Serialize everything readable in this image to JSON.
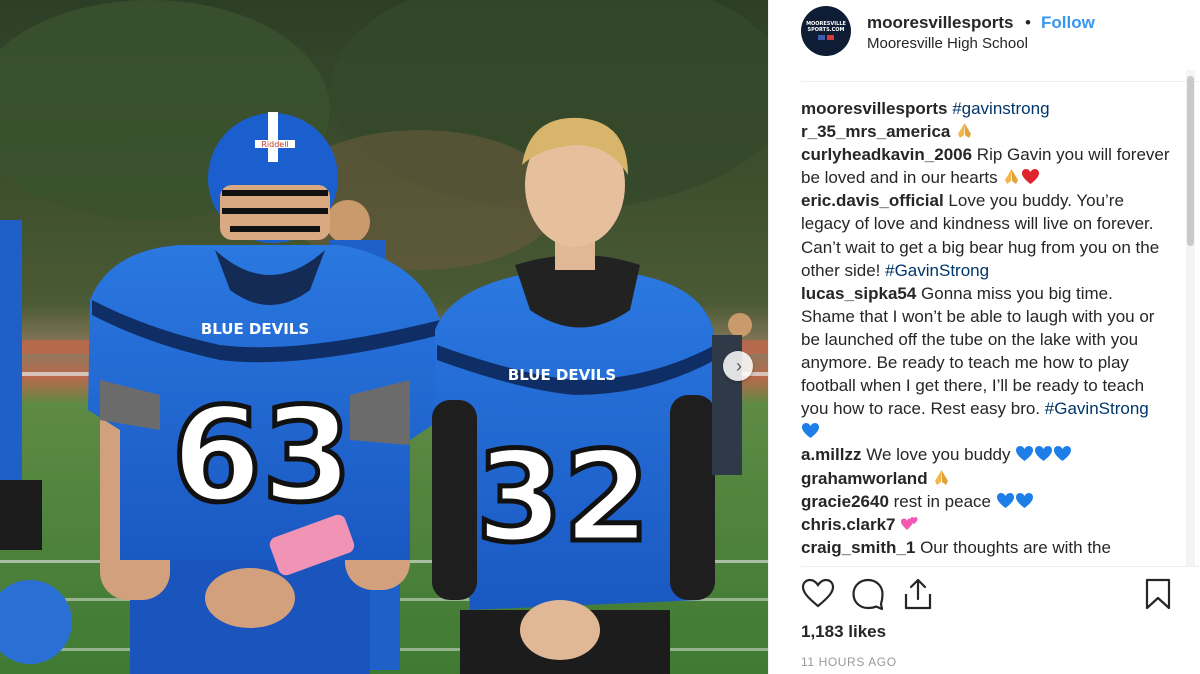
{
  "header": {
    "avatar_text": "MOORESVILLE SPORTS.COM",
    "username": "mooresvillesports",
    "separator": "•",
    "follow": "Follow",
    "location": "Mooresville High School"
  },
  "photo": {
    "jersey_left_number": "63",
    "jersey_right_number": "32",
    "jersey_text": "BLUE DEVILS",
    "helmet_brand": "Riddell",
    "colors": {
      "jersey": "#1e6bd6",
      "jersey_dark": "#0d3f8f",
      "field": "#4f7d3a",
      "sky_trees": "#2f4a2a"
    }
  },
  "comments": [
    {
      "user": "mooresvillesports",
      "text": "",
      "tag": "#gavinstrong",
      "after": "",
      "emoji": []
    },
    {
      "user": "r_35_mrs_america",
      "text": "",
      "tag": "",
      "after": "",
      "emoji": [
        "folded-hands"
      ]
    },
    {
      "user": "curlyheadkavin_2006",
      "text": "Rip Gavin you will forever be loved and in our hearts",
      "tag": "",
      "after": "",
      "emoji": [
        "folded-hands",
        "red-heart"
      ]
    },
    {
      "user": "eric.davis_official",
      "text": "Love you buddy. You’re legacy of love and kindness will live on forever. Can’t wait to get a big bear hug from you on the other side!",
      "tag": "#GavinStrong",
      "after": "",
      "emoji": []
    },
    {
      "user": "lucas_sipka54",
      "text": "Gonna miss you big time. Shame that I won’t be able to laugh with you or be launched off the tube on the lake with you anymore. Be ready to teach me how to play football when I get there, I’ll be ready to teach you how to race. Rest easy bro.",
      "tag": "#GavinStrong",
      "after": "",
      "emoji": [
        "blue-heart"
      ]
    },
    {
      "user": "a.millzz",
      "text": "We love you buddy",
      "tag": "",
      "after": "",
      "emoji": [
        "blue-heart",
        "blue-heart",
        "blue-heart"
      ]
    },
    {
      "user": "grahamworland",
      "text": "",
      "tag": "",
      "after": "",
      "emoji": [
        "folded-hands"
      ]
    },
    {
      "user": "gracie2640",
      "text": "rest in peace",
      "tag": "",
      "after": "",
      "emoji": [
        "blue-heart",
        "blue-heart"
      ]
    },
    {
      "user": "chris.clark7",
      "text": "",
      "tag": "",
      "after": "",
      "emoji": [
        "two-hearts"
      ]
    },
    {
      "user": "craig_smith_1",
      "text": "Our thoughts are with the",
      "tag": "",
      "after": "",
      "emoji": []
    }
  ],
  "actions": {
    "icons": [
      "heart-icon",
      "comment-icon",
      "share-icon",
      "bookmark-icon"
    ]
  },
  "likes": "1,183 likes",
  "timestamp": "11 HOURS AGO"
}
